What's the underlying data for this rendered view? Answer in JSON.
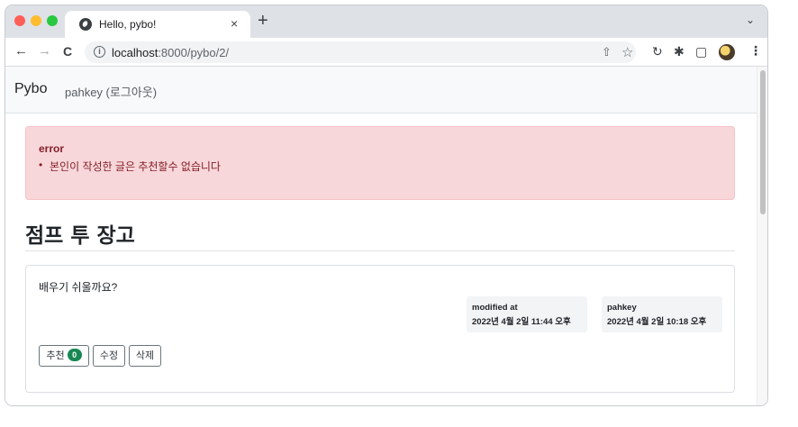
{
  "browser": {
    "tab_title": "Hello, pybo!",
    "tab_close": "×",
    "new_tab": "+",
    "tab_search": "⌄",
    "back": "←",
    "forward": "→",
    "reload": "C",
    "url_host": "localhost",
    "url_rest": ":8000/pybo/2/",
    "icons": [
      "info-icon",
      "share-icon",
      "star-icon",
      "reload-icon",
      "extensions-icon",
      "sidebar-icon",
      "profile-avatar",
      "menu-icon"
    ]
  },
  "navbar": {
    "brand": "Pybo",
    "user_link": "pahkey (로그아웃)"
  },
  "alert": {
    "title": "error",
    "message": "본인이 작성한 글은 추천할수 없습니다",
    "color": "#f8d7da"
  },
  "page": {
    "heading": "점프 투 장고"
  },
  "question": {
    "content": "배우기 쉬울까요?",
    "modified_label": "modified at",
    "modified_date": "2022년 4월 2일 11:44 오후",
    "author": "pahkey",
    "created_date": "2022년 4월 2일 10:18 오후",
    "buttons": {
      "recommend": "추천",
      "recommend_count": "0",
      "edit": "수정",
      "delete": "삭제"
    }
  },
  "colors": {
    "badge": "#198754",
    "alert_text": "#842029"
  }
}
